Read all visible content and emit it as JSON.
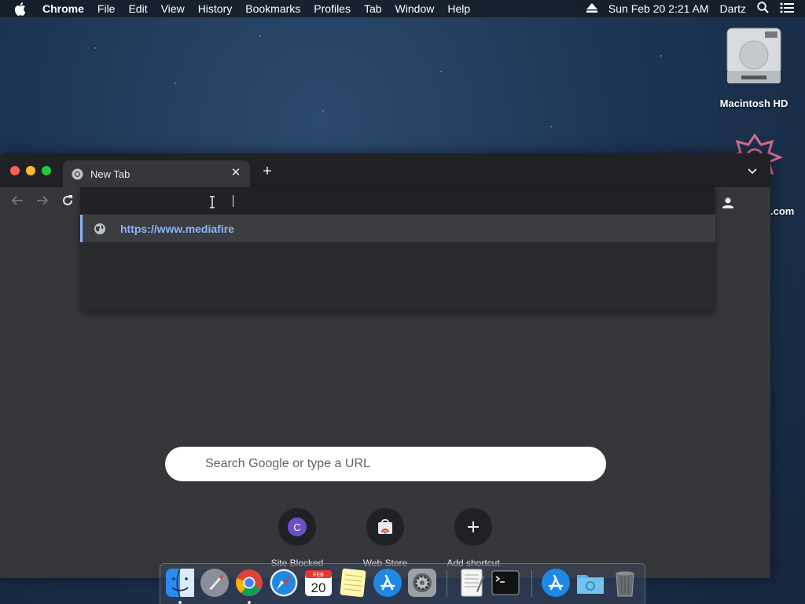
{
  "menubar": {
    "apple_icon": "apple-logo",
    "app_name": "Chrome",
    "items": [
      "File",
      "Edit",
      "View",
      "History",
      "Bookmarks",
      "Profiles",
      "Tab",
      "Window",
      "Help"
    ],
    "eject_icon": "eject-icon",
    "clock": "Sun Feb 20  2:21 AM",
    "user": "Dartz",
    "search_icon": "spotlight-search-icon",
    "list_icon": "notification-center-icon"
  },
  "desktop": {
    "icons": [
      {
        "label": "Macintosh HD",
        "icon": "hard-drive-icon"
      },
      {
        "label": ".com",
        "icon": "app-icon"
      }
    ]
  },
  "browser": {
    "tab": {
      "title": "New Tab",
      "favicon": "chrome-icon"
    },
    "omnibox": {
      "value": ""
    },
    "suggestion": {
      "icon": "globe-icon",
      "text": "https://www.mediafire"
    },
    "ntp": {
      "search_placeholder": "Search Google or type a URL",
      "shortcuts": [
        {
          "label": "Site Blocked",
          "icon": "letter-avatar",
          "letter": "C"
        },
        {
          "label": "Web Store",
          "icon": "web-store-icon"
        },
        {
          "label": "Add shortcut",
          "icon": "plus-icon"
        }
      ]
    }
  },
  "dock": {
    "items": [
      "Finder",
      "Launchpad",
      "Google Chrome",
      "Safari",
      "Calendar",
      "Notes",
      "App Store",
      "System Preferences",
      "TextEdit",
      "Terminal",
      "Applications",
      "Documents",
      "Trash"
    ],
    "calendar": {
      "month": "FEB",
      "day": "20"
    }
  },
  "colors": {
    "accent": "#8ab4f8",
    "window_bg": "#35363a",
    "tabstrip_bg": "#202124"
  }
}
